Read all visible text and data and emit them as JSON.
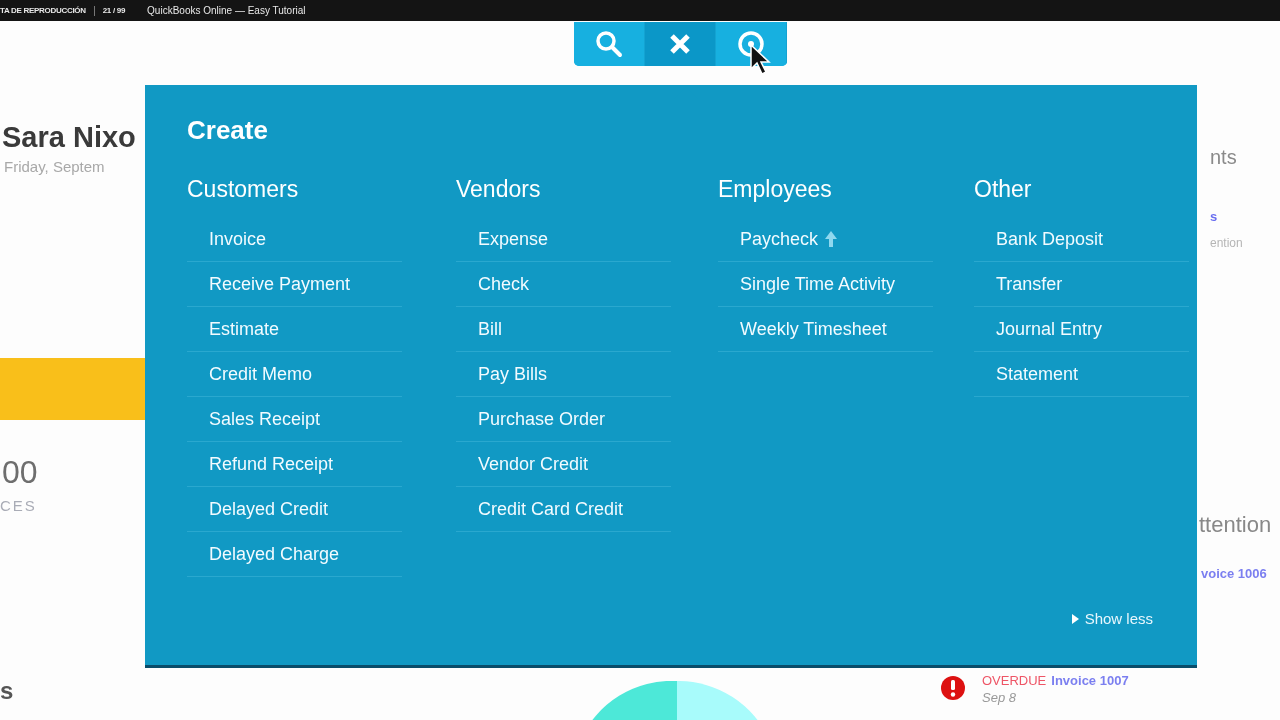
{
  "player_bar": {
    "playlist_label": "TA DE REPRODUCCIÓN",
    "position": "21 / 99",
    "video_title": "QuickBooks Online — Easy Tutorial"
  },
  "toolbar": [
    {
      "kind": "search",
      "selected": false
    },
    {
      "kind": "close",
      "selected": true
    },
    {
      "kind": "recent",
      "selected": false
    }
  ],
  "dashboard": {
    "user_name": "Sara Nixo",
    "date": "Friday, Septem",
    "amount": "00",
    "amount_label": "CES",
    "section_fragment": "s",
    "right_heading": "nts",
    "right_link": "s",
    "right_note": "ention",
    "attention_heading": "ttention",
    "invoice_link": "voice 1006",
    "overdue": {
      "status": "OVERDUE",
      "invoice": "Invoice 1007",
      "date": "Sep 8"
    }
  },
  "create_menu": {
    "title": "Create",
    "columns": [
      {
        "heading": "Customers",
        "items": [
          {
            "label": "Invoice"
          },
          {
            "label": "Receive Payment"
          },
          {
            "label": "Estimate"
          },
          {
            "label": "Credit Memo"
          },
          {
            "label": "Sales Receipt"
          },
          {
            "label": "Refund Receipt"
          },
          {
            "label": "Delayed Credit"
          },
          {
            "label": "Delayed Charge"
          }
        ]
      },
      {
        "heading": "Vendors",
        "items": [
          {
            "label": "Expense"
          },
          {
            "label": "Check"
          },
          {
            "label": "Bill"
          },
          {
            "label": "Pay Bills"
          },
          {
            "label": "Purchase Order"
          },
          {
            "label": "Vendor Credit"
          },
          {
            "label": "Credit Card Credit"
          }
        ]
      },
      {
        "heading": "Employees",
        "items": [
          {
            "label": "Paycheck",
            "upgrade": true
          },
          {
            "label": "Single Time Activity"
          },
          {
            "label": "Weekly Timesheet"
          }
        ]
      },
      {
        "heading": "Other",
        "items": [
          {
            "label": "Bank Deposit"
          },
          {
            "label": "Transfer"
          },
          {
            "label": "Journal Entry"
          },
          {
            "label": "Statement"
          }
        ]
      }
    ],
    "toggle": "Show less"
  }
}
